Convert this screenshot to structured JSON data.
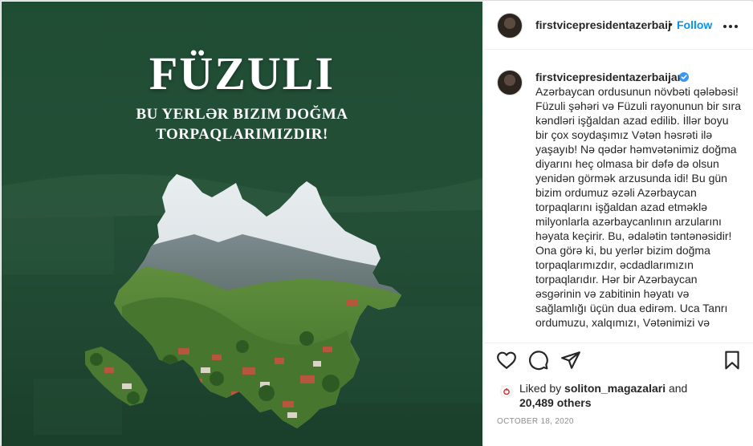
{
  "post_image": {
    "title": "FÜZULI",
    "subtitle_line1": "BU YERLƏR BIZIM DOĞMA",
    "subtitle_line2": "TORPAQLARIMIZDIR!",
    "colors": {
      "background": "#1e4a32",
      "accent_white": "#ffffff"
    }
  },
  "header": {
    "username": "firstvicepresidentazerbaijan",
    "separator": "•",
    "follow_label": "Follow",
    "more_icon": "more-horizontal-icon"
  },
  "caption": {
    "username": "firstvicepresidentazerbaijan",
    "verified_icon": "verified-badge-icon",
    "text": "Azərbaycan ordusunun növbəti qələbəsi! Füzuli şəhəri və Füzuli rayonunun bir sıra kəndləri işğaldan azad edilib. İllər boyu bir çox soydaşımız Vətən həsrəti ilə yaşayıb! Nə qədər həmvətənimiz doğma diyarını heç olmasa bir dəfə də olsun yenidən görmək arzusunda idi! Bu gün bizim ordumuz əzəli Azərbaycan torpaqlarını işğaldan azad etməklə milyonlarla azərbaycanlının arzularını həyata keçirir. Bu, ədalətin təntənəsidir! Ona görə ki, bu yerlər bizim doğma torpaqlarımızdır, əcdadlarımızın torpaqlarıdır. Hər bir Azərbaycan əsgərinin və zabitinin həyatı və sağlamlığı üçün dua edirəm. Uca Tanrı ordumuzu, xalqımızı, Vətənimizi və"
  },
  "actions": {
    "like_icon": "heart-icon",
    "comment_icon": "comment-icon",
    "share_icon": "paper-plane-icon",
    "save_icon": "bookmark-icon"
  },
  "likes": {
    "prefix": "Liked by",
    "user": "soliton_magazalari",
    "and": "and",
    "others": "20,489 others"
  },
  "date": "OCTOBER 18, 2020",
  "colors": {
    "link_blue": "#0095f6",
    "verified_blue": "#3897f0",
    "text": "#262626",
    "muted": "#8e8e8e"
  }
}
